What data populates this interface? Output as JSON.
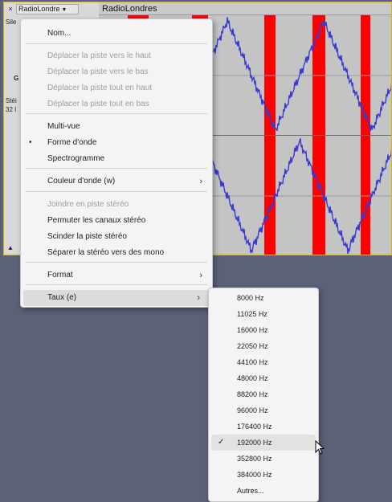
{
  "track": {
    "close_label": "×",
    "name_button_label": "RadioLondre",
    "title": "RadioLondres",
    "panel_line1": "Sile",
    "panel_line2": "G",
    "panel_line3": "Stéi",
    "panel_line4": "32 I"
  },
  "context_menu": {
    "items": [
      {
        "label": "Nom...",
        "enabled": true
      },
      {
        "label": "Déplacer la piste vers le haut",
        "enabled": false
      },
      {
        "label": "Déplacer la piste vers le bas",
        "enabled": false
      },
      {
        "label": "Déplacer la piste tout en haut",
        "enabled": false
      },
      {
        "label": "Déplacer la piste tout en bas",
        "enabled": false
      },
      {
        "label": "Multi-vue",
        "enabled": true
      },
      {
        "label": "Forme d'onde",
        "enabled": true,
        "checked": true,
        "bullet": "•"
      },
      {
        "label": "Spectrogramme",
        "enabled": true
      },
      {
        "label": "Couleur d'onde (w)",
        "enabled": true,
        "submenu": true
      },
      {
        "label": "Joindre en piste stéréo",
        "enabled": false
      },
      {
        "label": "Permuter les canaux stéréo",
        "enabled": true
      },
      {
        "label": "Scinder la piste stéréo",
        "enabled": true
      },
      {
        "label": "Séparer la stéréo vers des mono",
        "enabled": true
      },
      {
        "label": "Format",
        "enabled": true,
        "submenu": true
      },
      {
        "label": "Taux (e)",
        "enabled": true,
        "submenu": true,
        "highlighted": true
      }
    ]
  },
  "rate_submenu": {
    "items": [
      {
        "label": "8000 Hz"
      },
      {
        "label": "11025 Hz"
      },
      {
        "label": "16000 Hz"
      },
      {
        "label": "22050 Hz"
      },
      {
        "label": "44100 Hz"
      },
      {
        "label": "48000 Hz"
      },
      {
        "label": "88200 Hz"
      },
      {
        "label": "96000 Hz"
      },
      {
        "label": "176400 Hz"
      },
      {
        "label": "192000 Hz",
        "checked": true,
        "highlighted": true,
        "check_mark": "✓"
      },
      {
        "label": "352800 Hz"
      },
      {
        "label": "384000 Hz"
      },
      {
        "label": "Autres..."
      }
    ]
  },
  "colors": {
    "background": "#5c6178",
    "waveform": "#3a3ad0",
    "selection": "#ff0000",
    "track_bg": "#c9c9c9",
    "menu_bg": "#f4f4f4"
  },
  "icons": {
    "submenu_arrow": "›",
    "collapse": "▲",
    "dropdown": "▼"
  }
}
